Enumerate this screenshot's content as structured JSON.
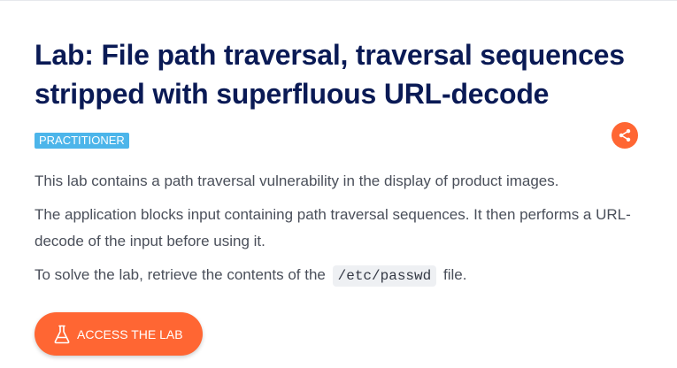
{
  "lab": {
    "title": "Lab: File path traversal, traversal sequences stripped with superfluous URL-decode",
    "level_badge": "PRACTITIONER",
    "share_icon": "share-icon",
    "description": [
      "This lab contains a path traversal vulnerability in the display of product images.",
      "The application blocks input containing path traversal sequences. It then performs a URL-decode of the input before using it."
    ],
    "solve": {
      "prefix": "To solve the lab, retrieve the contents of the",
      "file": "/etc/passwd",
      "suffix": "file."
    },
    "access_button": {
      "label": "ACCESS THE LAB",
      "icon": "flask-icon"
    }
  },
  "colors": {
    "title": "#0a1a55",
    "badge": "#4cb5ea",
    "accent": "#ff6633",
    "body_text": "#4a4f5a"
  }
}
